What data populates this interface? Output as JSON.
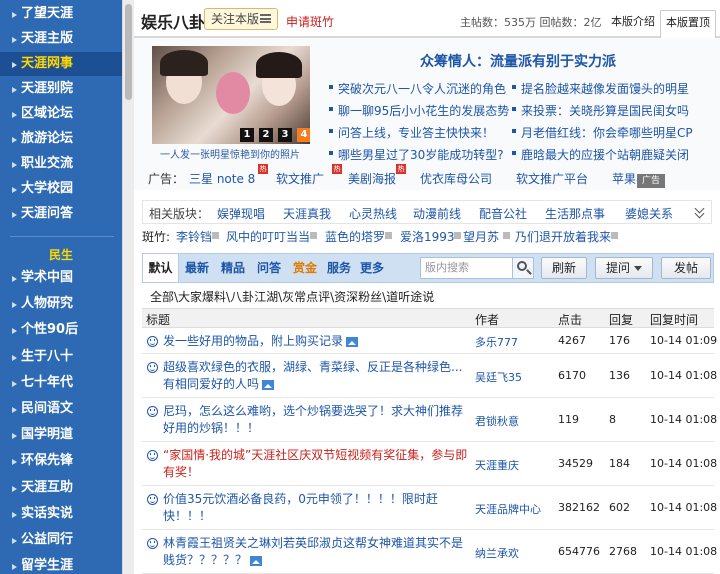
{
  "sidebar": {
    "group1": [
      {
        "label": "了望天涯"
      },
      {
        "label": "天涯主版"
      },
      {
        "label": "天涯网事",
        "active": true
      },
      {
        "label": "天涯别院"
      },
      {
        "label": "区域论坛"
      },
      {
        "label": "旅游论坛"
      },
      {
        "label": "职业交流"
      },
      {
        "label": "大学校园"
      },
      {
        "label": "天涯问答"
      }
    ],
    "group2_heading": "民生",
    "group2": [
      {
        "label": "学术中国"
      },
      {
        "label": "人物研究"
      },
      {
        "label": "个性90后"
      },
      {
        "label": "生于八十"
      },
      {
        "label": "七十年代"
      },
      {
        "label": "民间语文"
      },
      {
        "label": "国学明道"
      },
      {
        "label": "环保先锋"
      },
      {
        "label": "天涯互助"
      },
      {
        "label": "实话实说"
      },
      {
        "label": "公益同行"
      },
      {
        "label": "留学生涯"
      }
    ]
  },
  "header": {
    "board_name": "娱乐八卦",
    "follow_label": "关注本版",
    "apply_label": "申请斑竹",
    "stats": "主帖数：535万 回帖数：2亿",
    "intro_label": "本版介绍",
    "top_label": "本版置顶"
  },
  "feature": {
    "pages": [
      "1",
      "2",
      "3",
      "4"
    ],
    "active_page": 3,
    "caption": "一人发一张明星惊艳到你的照片",
    "headline": "众筹情人：流量派有别于实力派",
    "left_links": [
      "突破次元八一八令人沉迷的角色",
      "聊一聊95后小小花生的发展态势",
      "问答上线，专业答主快快来！",
      "哪些男星过了30岁能成功转型?"
    ],
    "right_links": [
      "提名脸越来越像发面馒头的明星",
      "来投票：关晓彤算是国民闺女吗",
      "月老借红线：你会牵哪些明星CP",
      "鹿晗最大的应援个站朝鹿疑关闭"
    ],
    "ads_label": "广告：",
    "ads": [
      "三星 note 8",
      "软文推广",
      "美剧海报",
      "优衣库母公司",
      "软文推广平台",
      "苹果8"
    ],
    "hot_badge": "热",
    "ad_tag": "广告"
  },
  "related": {
    "label": "相关版块：",
    "items": [
      "娱弹现唱",
      "天涯真我",
      "心灵热线",
      "动漫前线",
      "配音公社",
      "生活那点事",
      "婆媳关系"
    ]
  },
  "moderators": {
    "label": "斑竹:",
    "items": [
      "李铃铛",
      "风中的叮叮当当",
      "蓝色的塔罗",
      "爱洛1993",
      "望月苏",
      "乃们退开放着我来"
    ]
  },
  "toolbar": {
    "tabs": [
      "默认",
      "最新",
      "精品",
      "问答",
      "赏金",
      "服务",
      "更多"
    ],
    "search_placeholder": "版内搜索",
    "refresh_label": "刷新",
    "ask_label": "提问",
    "post_label": "发帖"
  },
  "categories": "全部\\大家爆料\\八卦江湖\\灰常点评\\资深粉丝\\道听途说",
  "table": {
    "headers": {
      "title": "标题",
      "author": "作者",
      "clicks": "点击",
      "replies": "回复",
      "time": "回复时间"
    },
    "rows": [
      {
        "title": "发一些好用的物品，附上购买记录",
        "author": "多乐777",
        "clicks": "4267",
        "replies": "176",
        "time": "10-14 01:09",
        "pic": true,
        "red": false
      },
      {
        "title": "超级喜欢绿色的衣服，湖绿、青菜绿、反正是各种绿色...有相同爱好的人吗",
        "author": "吴廷飞35",
        "clicks": "6170",
        "replies": "136",
        "time": "10-14 01:08",
        "pic": true,
        "red": false
      },
      {
        "title": "尼玛，怎么这么难哟，选个炒锅要选哭了！求大神们推荐好用的炒锅！！！",
        "author": "君锁秋意",
        "clicks": "119",
        "replies": "8",
        "time": "10-14 01:08",
        "pic": false,
        "red": false
      },
      {
        "title": "“家国情·我的城”天涯社区庆双节短视频有奖征集，参与即有奖！",
        "author": "天涯重庆",
        "clicks": "34529",
        "replies": "184",
        "time": "10-14 01:08",
        "pic": false,
        "red": true
      },
      {
        "title": "价值35元饮酒必备良药，0元申领了！！！！限时赶快！！！",
        "author": "天涯品牌中心",
        "clicks": "382162",
        "replies": "602",
        "time": "10-14 01:08",
        "pic": false,
        "red": false
      },
      {
        "title": "林青霞王祖贤关之琳刘若英邱淑贞这帮女神难道其实不是贱货？？？？？",
        "author": "纳兰承欢",
        "clicks": "654776",
        "replies": "2768",
        "time": "10-14 01:08",
        "pic": true,
        "red": false
      }
    ]
  },
  "colors": {
    "sidebar_bg": "#2d6ab3",
    "active_text": "#ffd800",
    "link": "#1e56a8",
    "red": "#c8211d"
  }
}
